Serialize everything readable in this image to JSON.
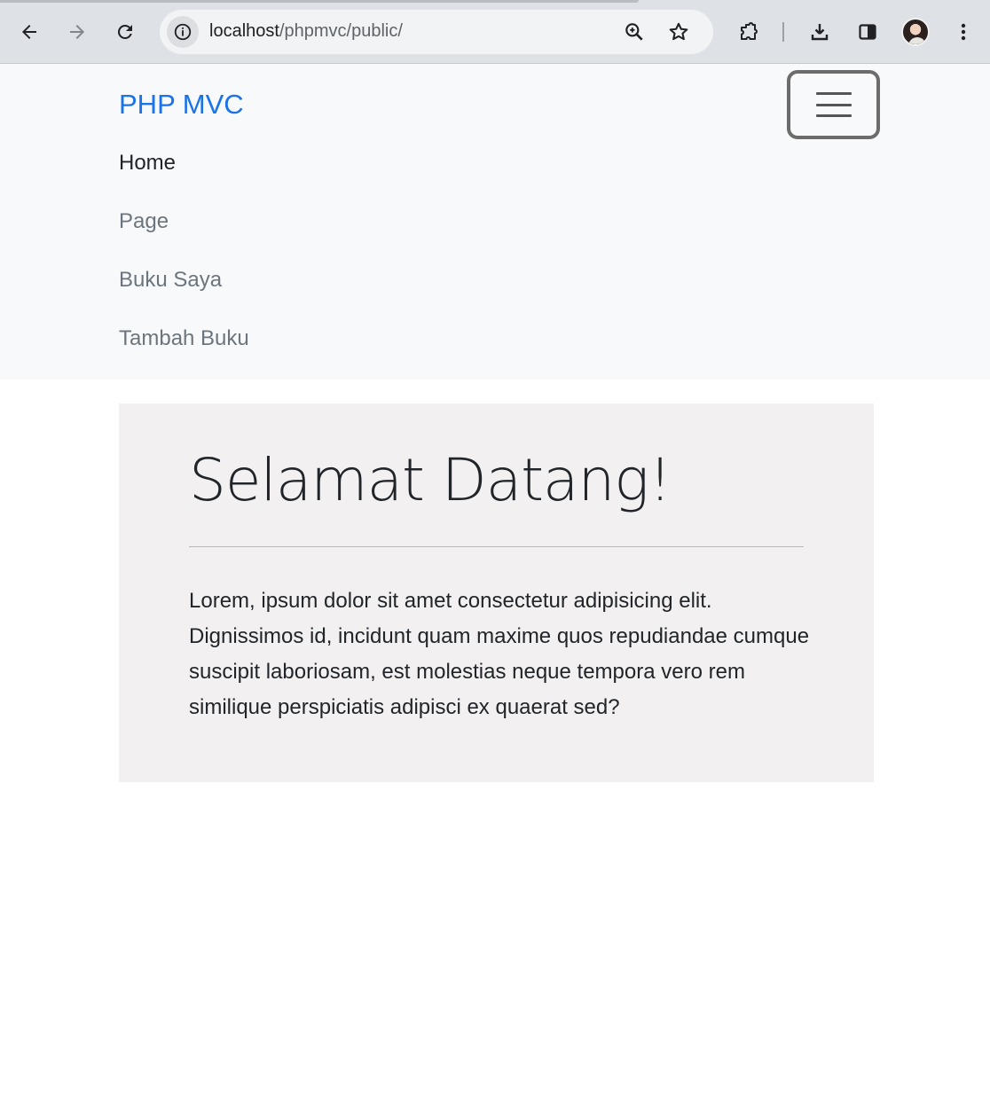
{
  "browser": {
    "url_host": "localhost",
    "url_path": "/phpmvc/public/",
    "icons": [
      "back-icon",
      "forward-icon",
      "reload-icon",
      "site-info-icon",
      "zoom-icon",
      "bookmark-star-icon",
      "extensions-icon",
      "download-icon",
      "side-panel-icon",
      "profile-avatar",
      "menu-kebab-icon"
    ]
  },
  "navbar": {
    "brand": "PHP MVC",
    "items": [
      {
        "label": "Home",
        "active": true
      },
      {
        "label": "Page",
        "active": false
      },
      {
        "label": "Buku Saya",
        "active": false
      },
      {
        "label": "Tambah Buku",
        "active": false
      }
    ]
  },
  "jumbotron": {
    "title": "Selamat Datang!",
    "body": "Lorem, ipsum dolor sit amet consectetur adipisicing elit. Dignissimos id, incidunt quam maxime quos repudiandae cumque suscipit laboriosam, est molestias neque tempora vero rem similique perspiciatis adipisci ex quaerat sed?"
  },
  "colors": {
    "brand": "#1a73e8",
    "navbar_bg": "#f8f9fa",
    "jumbotron_bg": "#f2f0f1",
    "text": "#212529",
    "muted": "#6c757d"
  }
}
